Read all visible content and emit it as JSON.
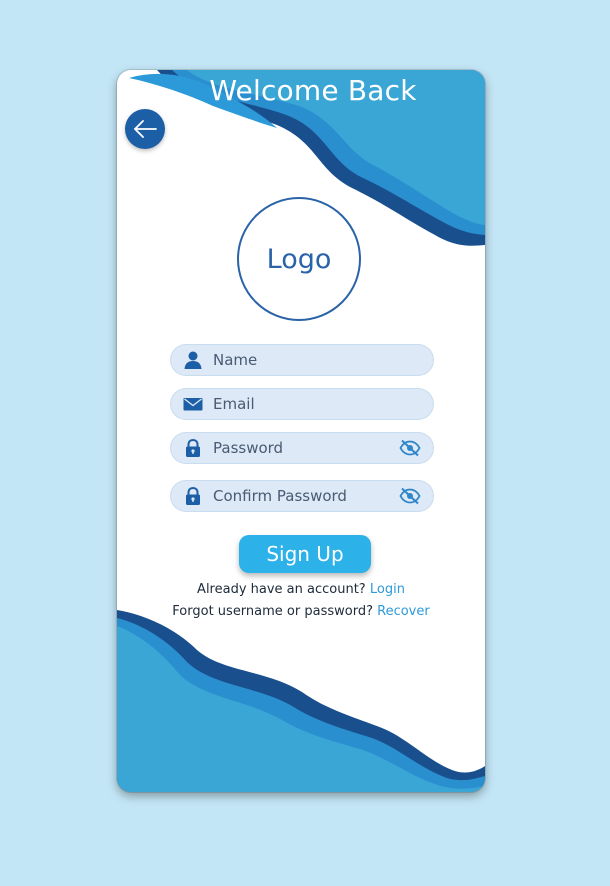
{
  "header": {
    "title": "Welcome Back"
  },
  "logo": {
    "text": "Logo"
  },
  "form": {
    "name_placeholder": "Name",
    "email_placeholder": "Email",
    "password_placeholder": "Password",
    "confirm_password_placeholder": "Confirm Password"
  },
  "actions": {
    "signup_label": "Sign Up",
    "account_prompt": "Already have an account?",
    "login_link": "Login",
    "forgot_prompt": "Forgot username or password?",
    "recover_link": "Recover"
  },
  "icons": {
    "back": "arrow-left-icon",
    "name": "user-icon",
    "email": "envelope-icon",
    "password": "lock-icon",
    "visibility": "eye-off-icon"
  },
  "colors": {
    "background": "#c3e6f6",
    "wave_light": "#3aa6d6",
    "wave_mid": "#2a8fcf",
    "wave_dark": "#1a4f8e",
    "primary_button": "#2cb2e8",
    "field_fill": "#dde9f7",
    "link": "#2e9ad8"
  }
}
